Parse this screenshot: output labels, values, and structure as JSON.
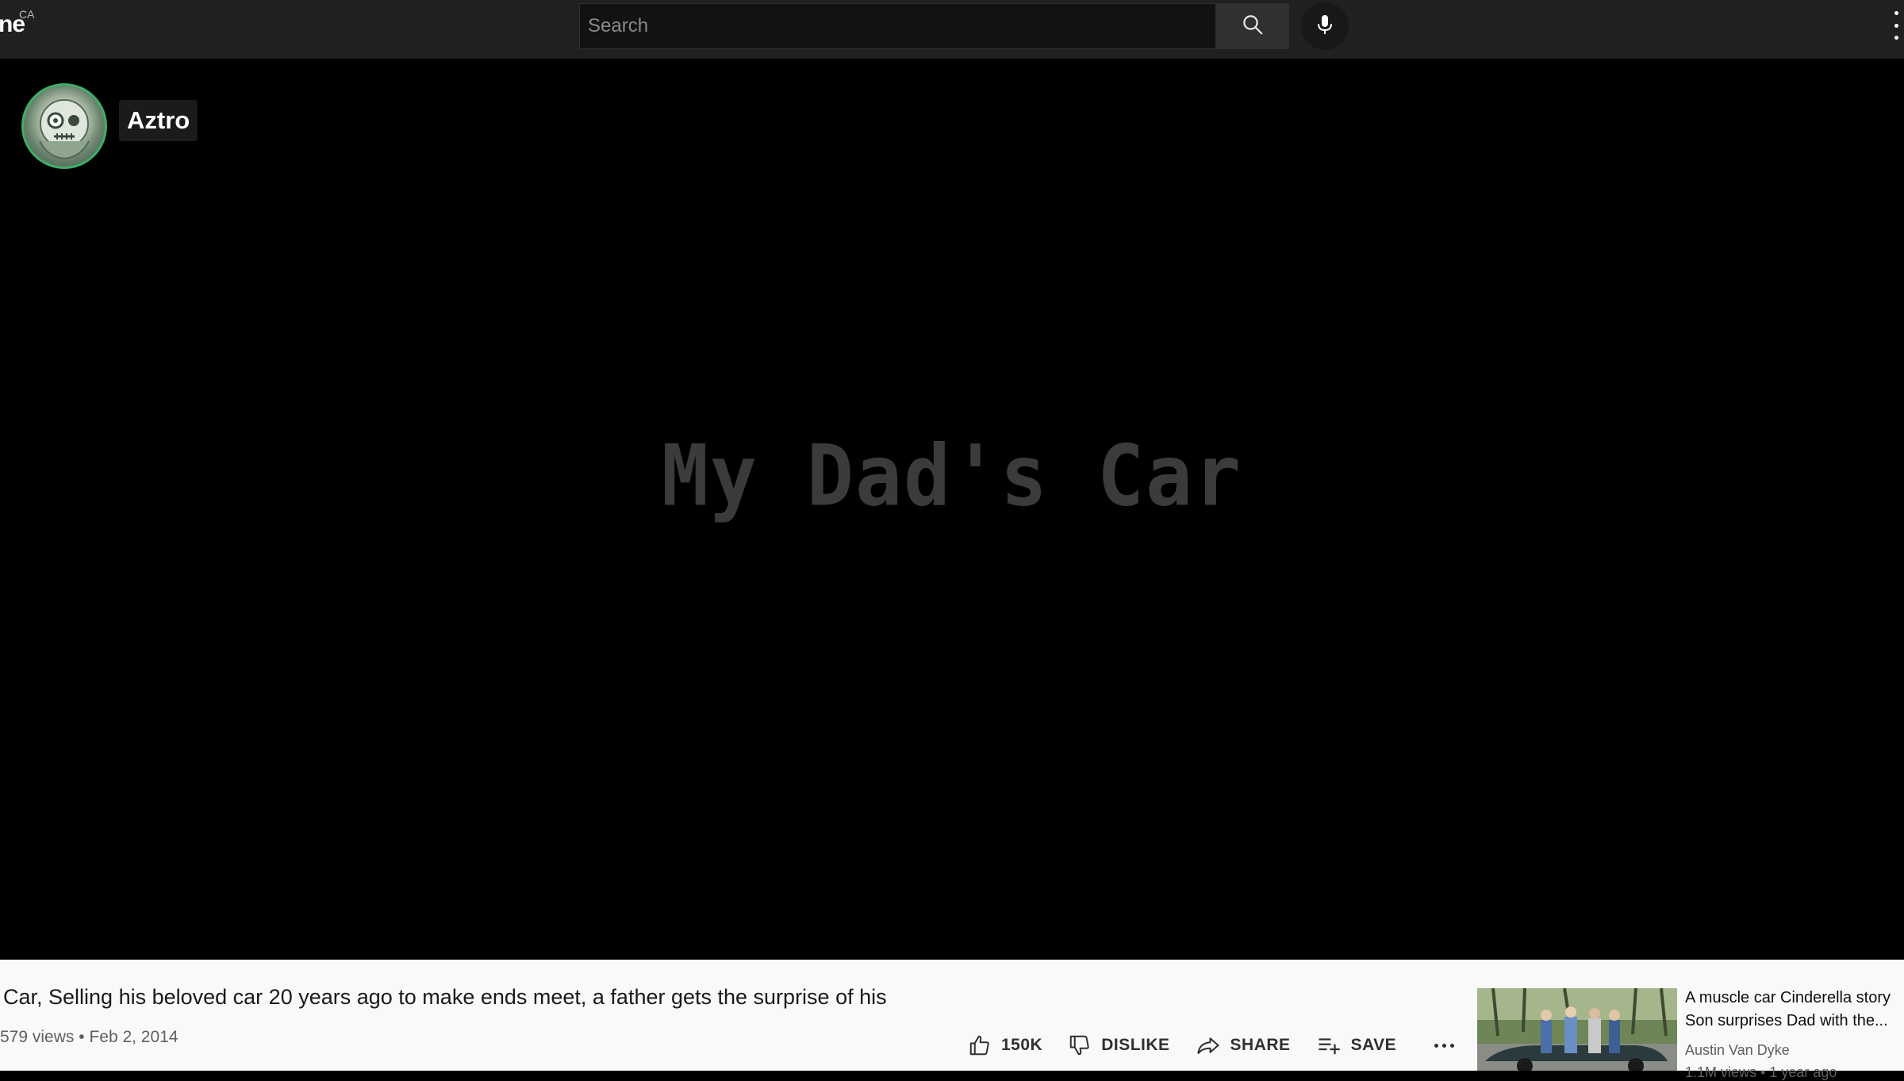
{
  "header": {
    "logo_fragment": "ne",
    "country_code": "CA",
    "search": {
      "placeholder": "Search",
      "value": ""
    }
  },
  "player": {
    "channel_name": "Aztro",
    "title_card": "My Dad's Car"
  },
  "video": {
    "title": "Car, Selling his beloved car 20 years ago to make ends meet, a father gets the surprise of his",
    "views": "579 views",
    "separator": "•",
    "date": "Feb 2, 2014",
    "actions": {
      "like_count": "150K",
      "dislike_label": "DISLIKE",
      "share_label": "SHARE",
      "save_label": "SAVE"
    }
  },
  "recommendation": {
    "title_line1": "A muscle car Cinderella story",
    "title_line2": "Son surprises Dad with the...",
    "channel": "Austin Van Dyke",
    "meta": "1.1M views • 1 year ago"
  },
  "icons": {
    "search": "search-icon",
    "mic": "mic-icon",
    "more": "more-vert-icon",
    "like": "thumb-up-icon",
    "dislike": "thumb-down-icon",
    "share": "share-icon",
    "save": "playlist-add-icon",
    "more_actions": "more-horiz-icon"
  },
  "colors": {
    "topbar_bg": "#202020",
    "player_bg": "#000000",
    "below_bg": "#f9f9f9",
    "avatar_ring": "#3fae68",
    "title_card_text": "#3b3b3b"
  }
}
